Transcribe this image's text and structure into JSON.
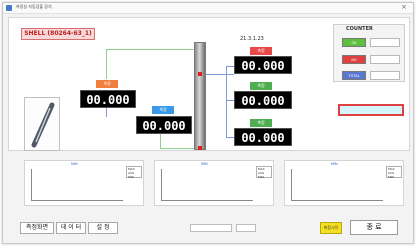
{
  "window": {
    "title": "측정실 자동검출 장치",
    "close_glyph": "×"
  },
  "part_code": "SHELL (80264-63_1)",
  "date": "21.3.1.23",
  "measurements": {
    "left": {
      "label": "측정",
      "value": "00.000",
      "color": "#f07e3c"
    },
    "center": {
      "label": "측정",
      "value": "00.000",
      "color": "#3a9ae8"
    },
    "right_top": {
      "label": "측정",
      "value": "00.000",
      "color": "#e84a4a"
    },
    "right_middle": {
      "label": "측정",
      "value": "00.000",
      "color": "#4fae4f"
    },
    "right_bottom": {
      "label": "측정",
      "value": "00.000",
      "color": "#4fae4f"
    }
  },
  "counter": {
    "title": "COUNTER",
    "rows": [
      {
        "label": "OK",
        "value": "",
        "color": "#5fbf3f"
      },
      {
        "label": "NG",
        "value": "",
        "color": "#e04040"
      },
      {
        "label": "TOTAL",
        "value": "",
        "color": "#5a78d0"
      }
    ]
  },
  "status_text": "",
  "graphs": [
    {
      "title": "MIN",
      "legend": [
        "MAX",
        "AVG",
        "MIN"
      ]
    },
    {
      "title": "MIN",
      "legend": [
        "MAX",
        "AVG",
        "MIN"
      ]
    },
    {
      "title": "MIN",
      "legend": [
        "MAX",
        "AVG",
        "MIN"
      ]
    }
  ],
  "bottom": {
    "measure_screen_button": "측정화면",
    "data_button": "데 이 터",
    "settings_button": "설    정",
    "yellow_button": "측정시작",
    "end_button": "종 료"
  },
  "icons": {
    "app": "app-icon",
    "close": "close-icon",
    "tool": "drill-bit-image"
  }
}
